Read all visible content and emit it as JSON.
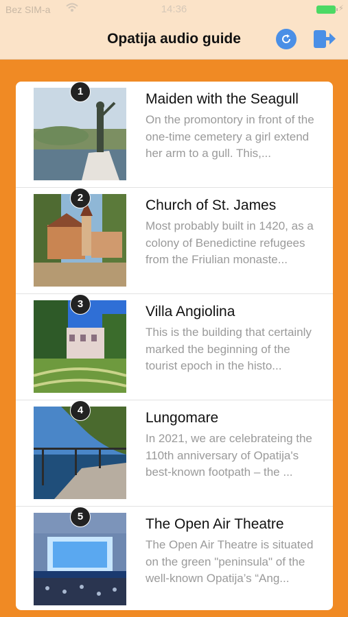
{
  "status_bar": {
    "carrier": "Bez SIM-a",
    "time": "14:36"
  },
  "navbar": {
    "title": "Opatija audio guide",
    "refresh_icon": "refresh-icon",
    "logout_icon": "logout-icon",
    "accent": "#4a8fe6"
  },
  "background_color": "#f08a24",
  "items": [
    {
      "number": "1",
      "title": "Maiden with the Seagull",
      "description": "On the promontory in front of the one-time cemetery a girl extend her arm to a gull. This,..."
    },
    {
      "number": "2",
      "title": "Church of St. James",
      "description": "Most probably built in 1420, as a colony of Benedictine refugees from the Friulian monaste..."
    },
    {
      "number": "3",
      "title": "Villa Angiolina",
      "description": "This is the building that certainly marked the beginning of the tourist epoch in the histo..."
    },
    {
      "number": "4",
      "title": "Lungomare",
      "description": "In 2021, we are celebrateing the 110th anniversary of Opatija's best-known footpath – the ..."
    },
    {
      "number": "5",
      "title": "The Open Air Theatre",
      "description": "The Open Air Theatre is situated on the green \"peninsula\" of the well-known Opatija’s “Ang..."
    }
  ]
}
